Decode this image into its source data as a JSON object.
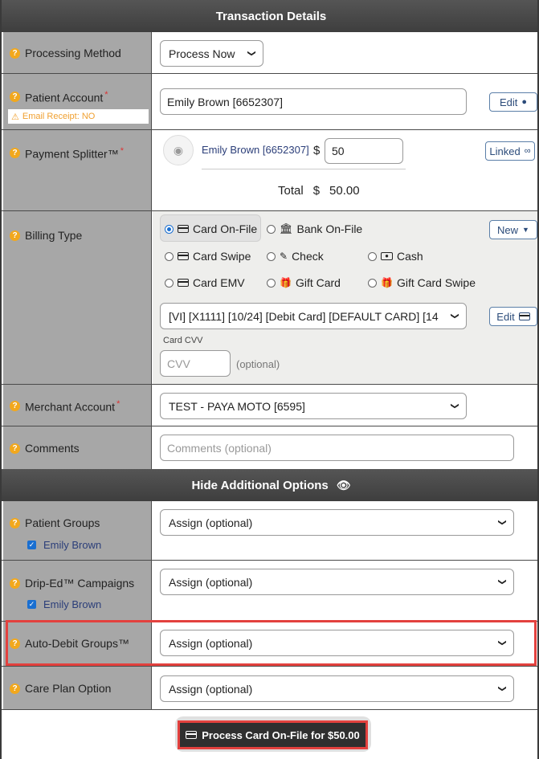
{
  "header": {
    "title": "Transaction Details"
  },
  "processing_method": {
    "label": "Processing Method",
    "value": "Process Now"
  },
  "patient_account": {
    "label": "Patient Account",
    "value": "Emily Brown [6652307]",
    "edit_label": "Edit",
    "email_receipt": "Email Receipt: NO"
  },
  "payment_splitter": {
    "label": "Payment Splitter™",
    "patient_name": "Emily Brown [6652307]",
    "currency": "$",
    "amount": "50",
    "linked_label": "Linked",
    "total_label": "Total",
    "total_currency": "$",
    "total_value": "50.00"
  },
  "billing_type": {
    "label": "Billing Type",
    "new_label": "New",
    "options": [
      {
        "label": "Card On-File",
        "icon": "credit-card-icon",
        "selected": true
      },
      {
        "label": "Bank On-File",
        "icon": "bank-icon",
        "selected": false
      },
      {
        "label": "Card Swipe",
        "icon": "credit-card-icon",
        "selected": false
      },
      {
        "label": "Check",
        "icon": "pencil-icon",
        "selected": false
      },
      {
        "label": "Cash",
        "icon": "money-icon",
        "selected": false
      },
      {
        "label": "Card EMV",
        "icon": "credit-card-icon",
        "selected": false
      },
      {
        "label": "Gift Card",
        "icon": "gift-icon",
        "selected": false
      },
      {
        "label": "Gift Card Swipe",
        "icon": "gift-icon",
        "selected": false
      }
    ],
    "card_select": "[VI] [X1111] [10/24] [Debit Card] [DEFAULT CARD] [14",
    "edit_label": "Edit",
    "cvv_label": "Card CVV",
    "cvv_placeholder": "CVV",
    "cvv_hint": "(optional)"
  },
  "merchant_account": {
    "label": "Merchant Account",
    "value": "TEST - PAYA MOTO [6595]"
  },
  "comments": {
    "label": "Comments",
    "placeholder": "Comments (optional)"
  },
  "additional": {
    "title": "Hide Additional Options"
  },
  "patient_groups": {
    "label": "Patient Groups",
    "sub_label": "Emily Brown",
    "value": "Assign (optional)"
  },
  "drip_ed": {
    "label": "Drip-Ed™ Campaigns",
    "sub_label": "Emily Brown",
    "value": "Assign (optional)"
  },
  "auto_debit": {
    "label": "Auto-Debit Groups™",
    "value": "Assign (optional)"
  },
  "care_plan": {
    "label": "Care Plan Option",
    "value": "Assign (optional)"
  },
  "process_button": {
    "label": "Process Card On-File for $50.00"
  },
  "colors": {
    "header_bg": "#3e3e3e",
    "label_bg": "#a7a7a7",
    "accent": "#1a6fd1",
    "highlight": "#e3413e",
    "warning": "#f0a030"
  }
}
